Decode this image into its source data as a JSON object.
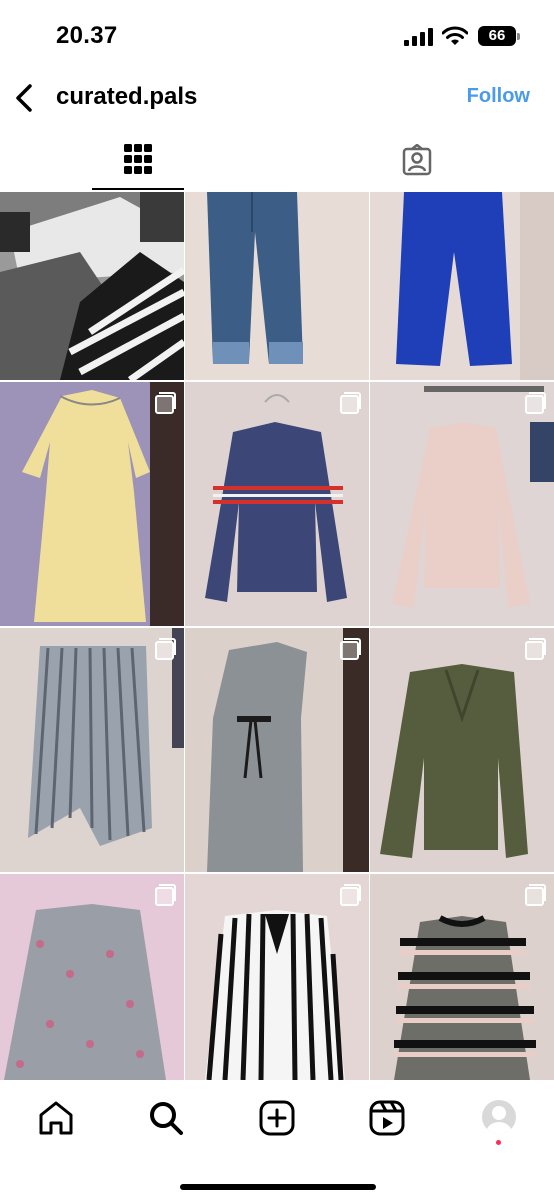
{
  "status_bar": {
    "time": "20.37",
    "battery": "66",
    "icons": [
      "signal-icon",
      "wifi-icon",
      "battery-icon"
    ]
  },
  "header": {
    "username": "curated.pals",
    "follow_label": "Follow",
    "accent_color": "#4a9bea"
  },
  "tabs": [
    {
      "icon": "grid-icon",
      "selected": true
    },
    {
      "icon": "tagged-icon",
      "selected": false
    }
  ],
  "grid": {
    "posts": [
      {
        "subject": "folded monochrome clothes pile",
        "multi": false
      },
      {
        "subject": "denim jeans",
        "multi": false
      },
      {
        "subject": "royal blue trousers",
        "multi": false
      },
      {
        "subject": "yellow tiered dress",
        "multi": true
      },
      {
        "subject": "navy sweatshirt with red stripes",
        "multi": true
      },
      {
        "subject": "pink knit sweater",
        "multi": true
      },
      {
        "subject": "grey striped skirt",
        "multi": true
      },
      {
        "subject": "grey long dress with black belt",
        "multi": true
      },
      {
        "subject": "olive green blouse",
        "multi": true
      },
      {
        "subject": "grey floral wrap blouse",
        "multi": true
      },
      {
        "subject": "black and white striped blouse",
        "multi": true
      },
      {
        "subject": "black and pink striped knit top",
        "multi": true
      }
    ]
  },
  "bottom_nav": {
    "items": [
      "home-icon",
      "search-icon",
      "create-icon",
      "reels-icon",
      "profile-avatar"
    ]
  }
}
